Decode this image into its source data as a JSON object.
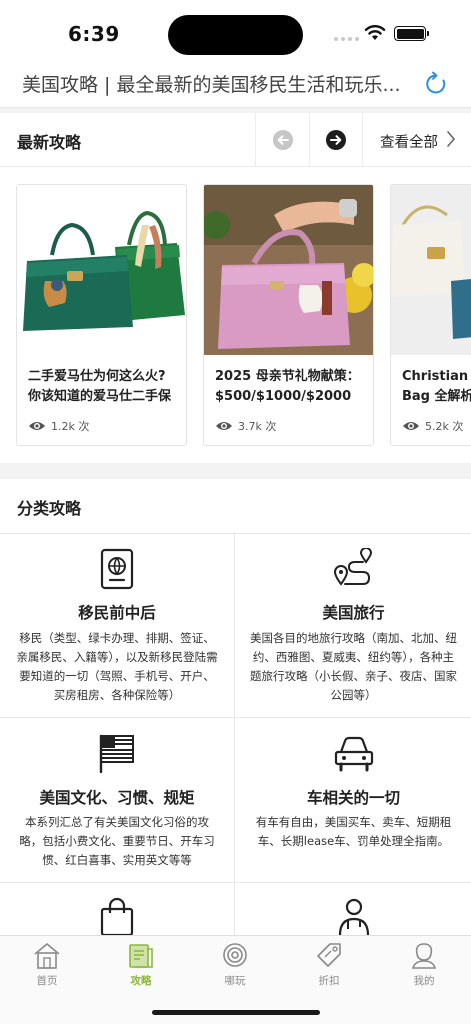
{
  "status_bar": {
    "time": "6:39"
  },
  "header": {
    "title": "美国攻略 | 最全最新的美国移民生活和玩乐..."
  },
  "latest": {
    "title": "最新攻略",
    "view_all": "查看全部",
    "cards": [
      {
        "title_line1": "二手爱马仕为何这么火?",
        "title_line2": "你该知道的爱马仕二手保",
        "views": "1.2k 次"
      },
      {
        "title_line1": "2025 母亲节礼物献策：",
        "title_line2": "$500/$1000/$2000",
        "views": "3.7k 次"
      },
      {
        "title_line1": "Christian Dior",
        "title_line2": "Bag 全解析",
        "views": "5.2k 次"
      }
    ]
  },
  "categories": {
    "title": "分类攻略",
    "items": [
      {
        "title": "移民前中后",
        "desc": "移民（类型、绿卡办理、排期、签证、亲属移民、入籍等），以及新移民登陆需要知道的一切（驾照、手机号、开户、买房租房、各种保险等）",
        "icon": "passport-icon"
      },
      {
        "title": "美国旅行",
        "desc": "美国各目的地旅行攻略（南加、北加、纽约、西雅图、夏威夷、纽约等），各种主题旅行攻略（小长假、亲子、夜店、国家公园等）",
        "icon": "route-icon"
      },
      {
        "title": "美国文化、习惯、规矩",
        "desc": "本系列汇总了有关美国文化习俗的攻略，包括小费文化、重要节日、开车习惯、红白喜事、实用英文等等",
        "icon": "flag-icon"
      },
      {
        "title": "车相关的一切",
        "desc": "有车有自由，美国买车、卖车、短期租车、长期lease车、罚单处理全指南。",
        "icon": "car-icon"
      },
      {
        "title": "",
        "desc": "",
        "icon": "shopping-bag-icon"
      },
      {
        "title": "",
        "desc": "",
        "icon": "doctor-icon"
      }
    ]
  },
  "tabs": [
    {
      "label": "首页",
      "icon": "home-icon",
      "active": false
    },
    {
      "label": "攻略",
      "icon": "guide-icon",
      "active": true
    },
    {
      "label": "哪玩",
      "icon": "target-icon",
      "active": false
    },
    {
      "label": "折扣",
      "icon": "tag-icon",
      "active": false
    },
    {
      "label": "我的",
      "icon": "user-icon",
      "active": false
    }
  ],
  "colors": {
    "accent": "#8bb83a",
    "refresh": "#2f8fe0",
    "divider": "#e6e6e6"
  }
}
